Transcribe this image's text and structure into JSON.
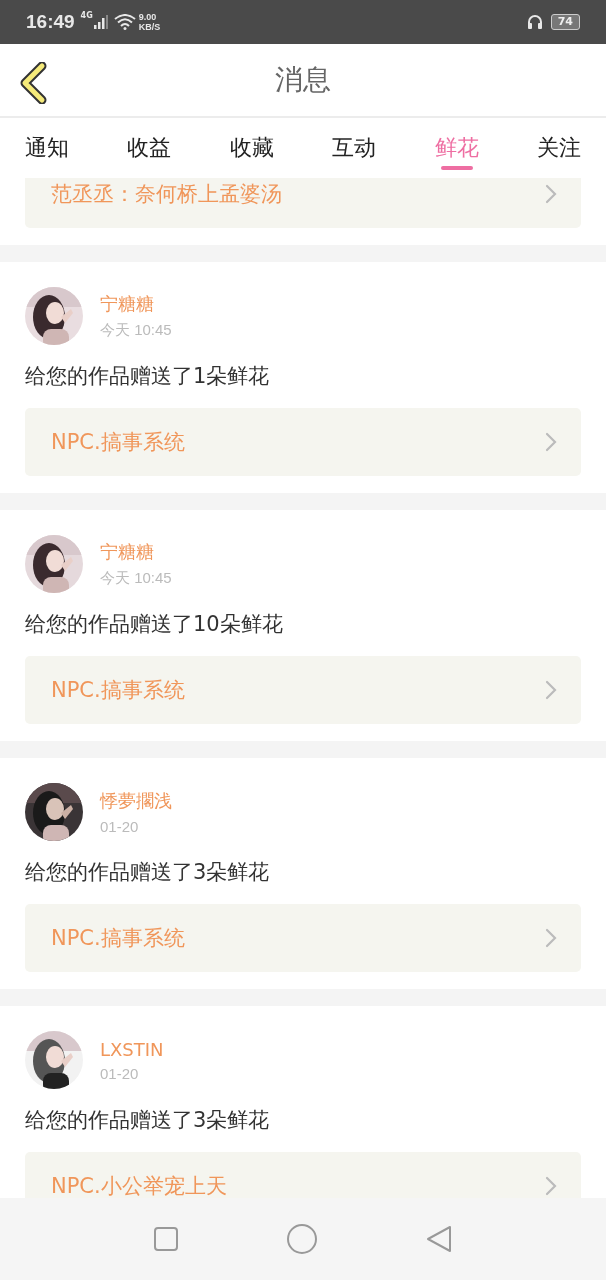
{
  "status_bar": {
    "time": "16:49",
    "network": "4G",
    "speed": "9.00",
    "speed_unit": "KB/S",
    "battery": "74"
  },
  "header": {
    "title": "消息"
  },
  "tabs": [
    {
      "label": "通知",
      "selected": false
    },
    {
      "label": "收益",
      "selected": false
    },
    {
      "label": "收藏",
      "selected": false
    },
    {
      "label": "互动",
      "selected": false
    },
    {
      "label": "鲜花",
      "selected": true
    },
    {
      "label": "关注",
      "selected": false
    }
  ],
  "top_partial_work": "范丞丞：奈何桥上孟婆汤",
  "messages": [
    {
      "name": "宁糖糖",
      "time": "今天 10:45",
      "text": "给您的作品赠送了1朵鲜花",
      "work": "NPC.搞事系统"
    },
    {
      "name": "宁糖糖",
      "time": "今天 10:45",
      "text": "给您的作品赠送了10朵鲜花",
      "work": "NPC.搞事系统"
    },
    {
      "name": "悸夢擱浅",
      "time": "01-20",
      "text": "给您的作品赠送了3朵鲜花",
      "work": "NPC.搞事系统"
    },
    {
      "name": "LXSTIN",
      "time": "01-20",
      "text": "给您的作品赠送了3朵鲜花",
      "work": "NPC.小公举宠上天"
    }
  ]
}
